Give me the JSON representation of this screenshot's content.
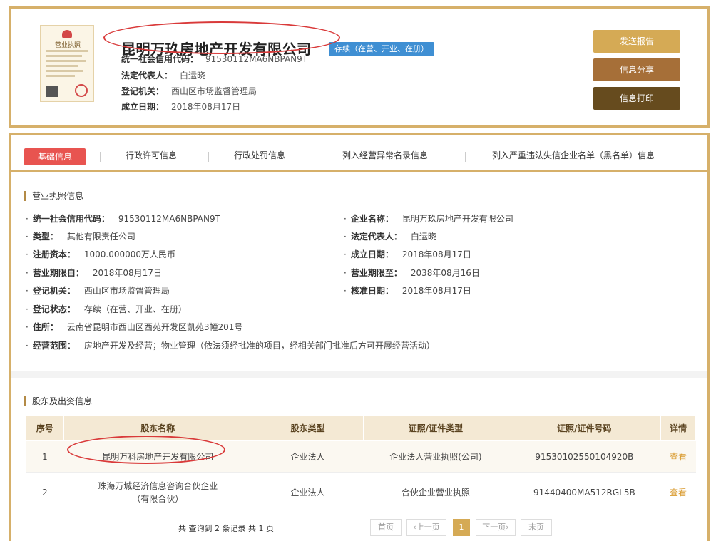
{
  "header": {
    "license_title": "营业执照",
    "company_name": "昆明万玖房地产开发有限公司",
    "status": "存续（在营、开业、在册）",
    "credit_code_label": "统一社会信用代码：",
    "credit_code": "91530112MA6NBPAN9T",
    "legal_rep_label": "法定代表人：",
    "legal_rep": "白运晓",
    "authority_label": "登记机关：",
    "authority": "西山区市场监督管理局",
    "established_label": "成立日期：",
    "established": "2018年08月17日"
  },
  "actions": {
    "send_report": "发送报告",
    "share": "信息分享",
    "print": "信息打印"
  },
  "tabs": [
    {
      "label": "基础信息"
    },
    {
      "label": "行政许可信息"
    },
    {
      "label": "行政处罚信息"
    },
    {
      "label": "列入经营异常名录信息"
    },
    {
      "label": "列入严重违法失信企业名单（黑名单）信息"
    }
  ],
  "license_section": {
    "title": "营业执照信息",
    "left": [
      {
        "k": "统一社会信用代码：",
        "v": "91530112MA6NBPAN9T"
      },
      {
        "k": "类型：",
        "v": "其他有限责任公司"
      },
      {
        "k": "注册资本：",
        "v": "1000.000000万人民币"
      },
      {
        "k": "营业期限自：",
        "v": "2018年08月17日"
      },
      {
        "k": "登记机关：",
        "v": "西山区市场监督管理局"
      },
      {
        "k": "登记状态：",
        "v": "存续（在营、开业、在册）"
      },
      {
        "k": "住所：",
        "v": "云南省昆明市西山区西苑开发区凯苑3幢201号"
      },
      {
        "k": "经营范围：",
        "v": "房地产开发及经营；物业管理（依法须经批准的项目，经相关部门批准后方可开展经营活动）"
      }
    ],
    "right": [
      {
        "k": "企业名称：",
        "v": "昆明万玖房地产开发有限公司"
      },
      {
        "k": "法定代表人：",
        "v": "白运晓"
      },
      {
        "k": "成立日期：",
        "v": "2018年08月17日"
      },
      {
        "k": "营业期限至：",
        "v": "2038年08月16日"
      },
      {
        "k": "核准日期：",
        "v": "2018年08月17日"
      }
    ]
  },
  "shareholder_section": {
    "title": "股东及出资信息",
    "columns": [
      "序号",
      "股东名称",
      "股东类型",
      "证照/证件类型",
      "证照/证件号码",
      "详情"
    ],
    "rows": [
      {
        "no": "1",
        "name": "昆明万科房地产开发有限公司",
        "type": "企业法人",
        "cert_type": "企业法人营业执照(公司)",
        "cert_no": "91530102550104920B",
        "detail": "查看"
      },
      {
        "no": "2",
        "name": "珠海万城经济信息咨询合伙企业（有限合伙）",
        "type": "企业法人",
        "cert_type": "合伙企业营业执照",
        "cert_no": "91440400MA512RGL5B",
        "detail": "查看"
      }
    ]
  },
  "pagination": {
    "summary": "共 查询到 2 条记录 共 1 页",
    "first": "首页",
    "prev": "‹上一页",
    "current": "1",
    "next": "下一页›",
    "last": "末页"
  },
  "colors": {
    "gold_border": "#d6b06a",
    "active_tab": "#e85450",
    "badge_blue": "#3f8fd3",
    "annotation_red": "#d93a3a"
  }
}
